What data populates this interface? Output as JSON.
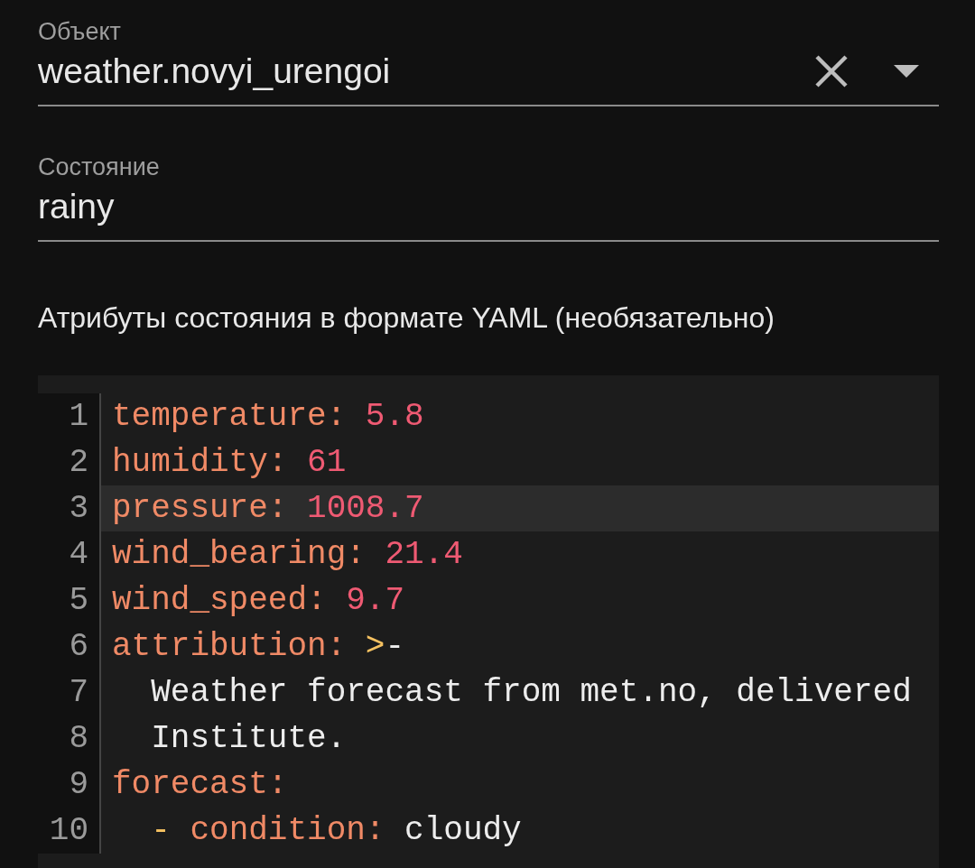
{
  "entity_field": {
    "label": "Объект",
    "value": "weather.novyi_urengoi"
  },
  "state_field": {
    "label": "Состояние",
    "value": "rainy"
  },
  "attributes_heading": "Атрибуты состояния в формате YAML (необязательно)",
  "code_editor": {
    "lines": [
      {
        "number": "1",
        "selected": false,
        "tokens": [
          {
            "kind": "key",
            "text": "temperature"
          },
          {
            "kind": "punct",
            "text": ": "
          },
          {
            "kind": "number",
            "text": "5.8"
          }
        ]
      },
      {
        "number": "2",
        "selected": false,
        "tokens": [
          {
            "kind": "key",
            "text": "humidity"
          },
          {
            "kind": "punct",
            "text": ": "
          },
          {
            "kind": "number",
            "text": "61"
          }
        ]
      },
      {
        "number": "3",
        "selected": true,
        "tokens": [
          {
            "kind": "key",
            "text": "pressure"
          },
          {
            "kind": "punct",
            "text": ": "
          },
          {
            "kind": "number",
            "text": "1008.7"
          }
        ]
      },
      {
        "number": "4",
        "selected": false,
        "tokens": [
          {
            "kind": "key",
            "text": "wind_bearing"
          },
          {
            "kind": "punct",
            "text": ": "
          },
          {
            "kind": "number",
            "text": "21.4"
          }
        ]
      },
      {
        "number": "5",
        "selected": false,
        "tokens": [
          {
            "kind": "key",
            "text": "wind_speed"
          },
          {
            "kind": "punct",
            "text": ": "
          },
          {
            "kind": "number",
            "text": "9.7"
          }
        ]
      },
      {
        "number": "6",
        "selected": false,
        "tokens": [
          {
            "kind": "key",
            "text": "attribution"
          },
          {
            "kind": "punct",
            "text": ": "
          },
          {
            "kind": "indicator",
            "text": ">"
          },
          {
            "kind": "plain",
            "text": "-"
          }
        ]
      },
      {
        "number": "7",
        "selected": false,
        "indented": true,
        "tokens": [
          {
            "kind": "plain",
            "text": "Weather forecast from met.no, delivered"
          }
        ]
      },
      {
        "number": "8",
        "selected": false,
        "indented": true,
        "tokens": [
          {
            "kind": "plain",
            "text": "Institute."
          }
        ]
      },
      {
        "number": "9",
        "selected": false,
        "tokens": [
          {
            "kind": "key",
            "text": "forecast"
          },
          {
            "kind": "punct",
            "text": ":"
          }
        ]
      },
      {
        "number": "10",
        "selected": false,
        "indented": true,
        "tokens": [
          {
            "kind": "indicator",
            "text": "- "
          },
          {
            "kind": "key",
            "text": "condition"
          },
          {
            "kind": "punct",
            "text": ": "
          },
          {
            "kind": "plain",
            "text": "cloudy"
          }
        ]
      }
    ]
  }
}
